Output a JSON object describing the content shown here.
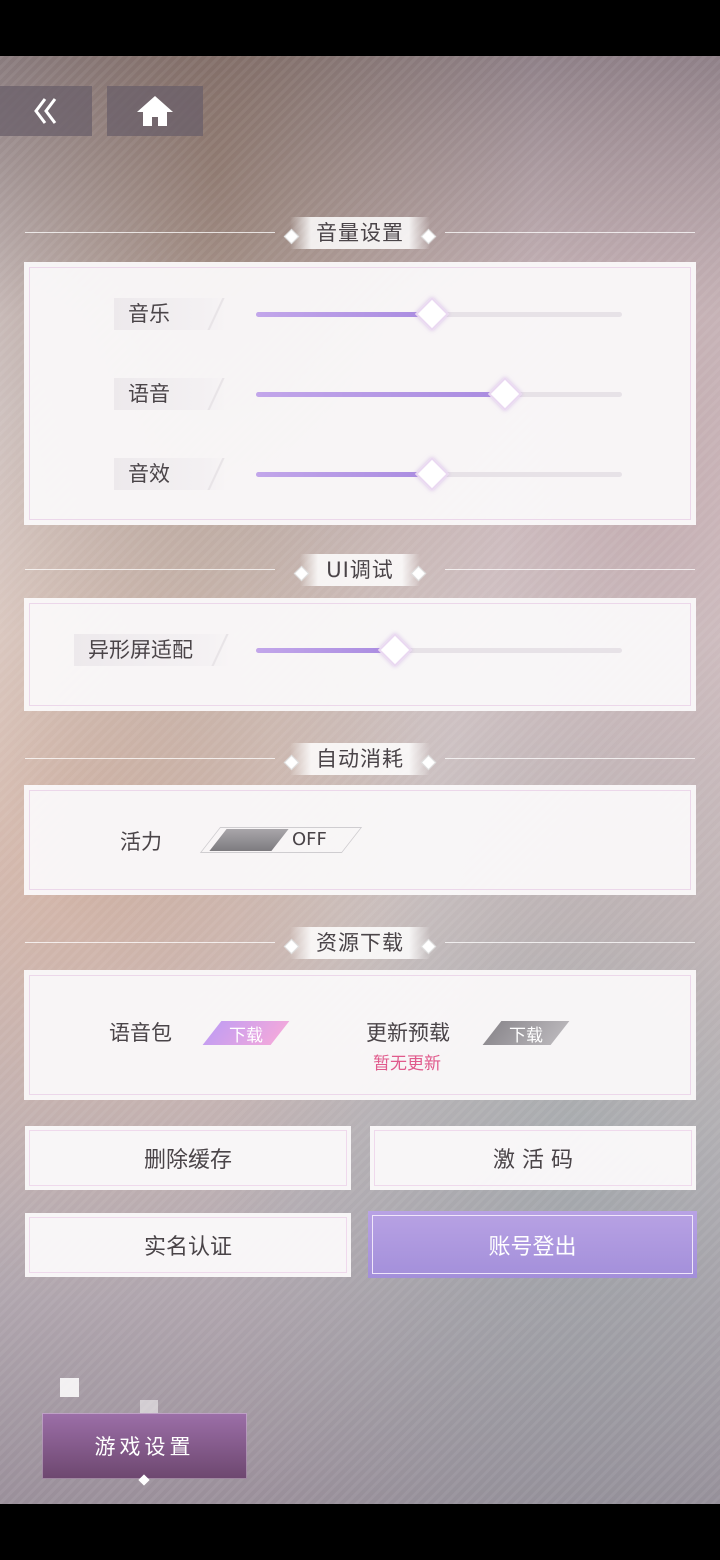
{
  "nav": {
    "back_icon": "double-chevron-left-icon",
    "home_icon": "home-icon"
  },
  "sections": {
    "volume": {
      "title": "音量设置"
    },
    "ui_debug": {
      "title": "UI调试"
    },
    "auto_consume": {
      "title": "自动消耗"
    },
    "resources": {
      "title": "资源下载"
    }
  },
  "volume": {
    "music": {
      "label": "音乐",
      "value": 0.48
    },
    "voice": {
      "label": "语音",
      "value": 0.68
    },
    "sfx": {
      "label": "音效",
      "value": 0.48
    }
  },
  "ui_debug": {
    "notch": {
      "label": "异形屏适配",
      "value": 0.38
    }
  },
  "auto_consume": {
    "vitality": {
      "label": "活力",
      "state": "OFF"
    }
  },
  "resources": {
    "voice_pack": {
      "label": "语音包",
      "button": "下载"
    },
    "update_preload": {
      "label": "更新预载",
      "button": "下载",
      "status": "暂无更新"
    }
  },
  "actions": {
    "clear_cache": "删除缓存",
    "activation_code": "激 活 码",
    "real_name": "实名认证",
    "logout": "账号登出"
  },
  "bottom_tab": {
    "label": "游戏设置"
  },
  "colors": {
    "accent": "#a98be0",
    "pink": "#e05a8c",
    "logout_button": "#b09ae0"
  }
}
